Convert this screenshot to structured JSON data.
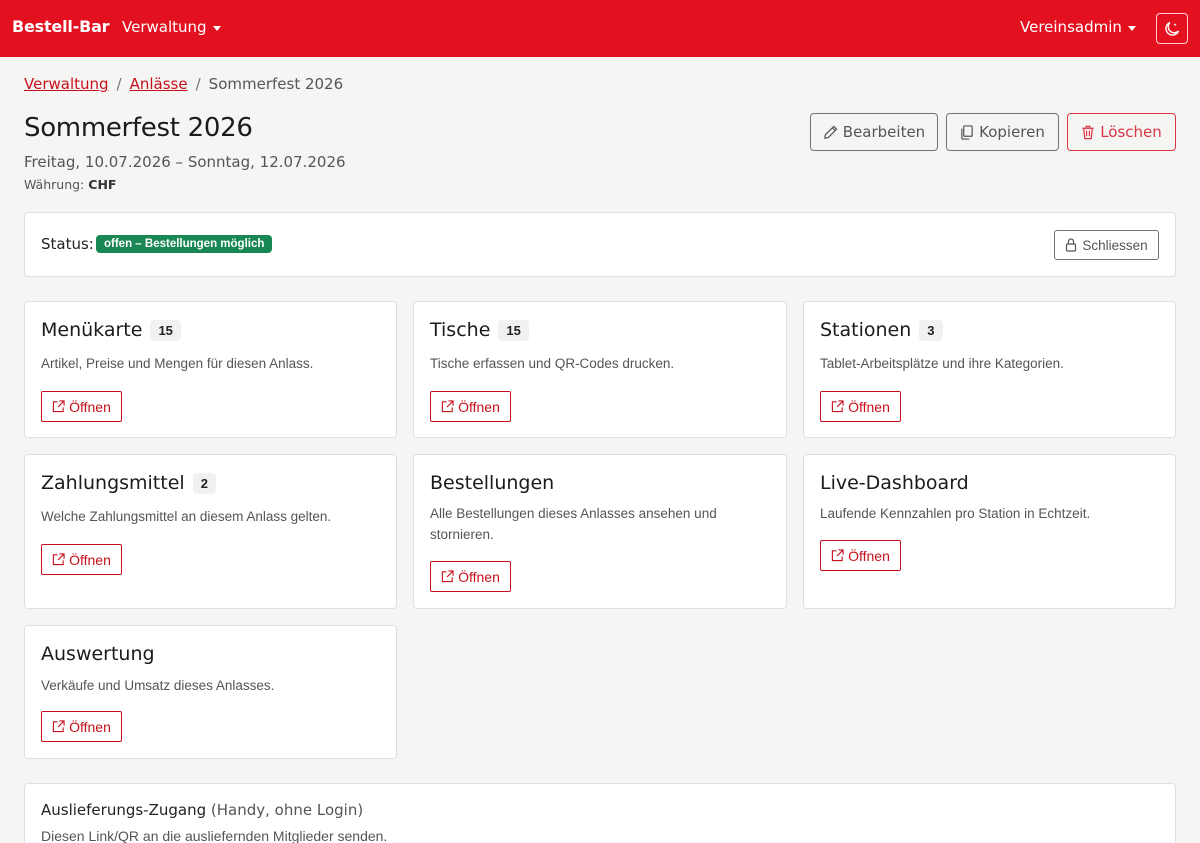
{
  "nav": {
    "brand": "Bestell-Bar",
    "admin_menu": "Verwaltung",
    "user_menu": "Vereinsadmin"
  },
  "breadcrumb": {
    "items": [
      "Verwaltung",
      "Anlässe"
    ],
    "separator": "/",
    "current": "Sommerfest 2026"
  },
  "header": {
    "title": "Sommerfest 2026",
    "dates": "Freitag, 10.07.2026 – Sonntag, 12.07.2026",
    "currency_label": "Währung:",
    "currency_value": "CHF",
    "edit_label": "Bearbeiten",
    "copy_label": "Kopieren",
    "delete_label": "Löschen"
  },
  "status": {
    "label": "Status:",
    "badge": "offen – Bestellungen möglich",
    "close_label": "Schliessen"
  },
  "cards": [
    {
      "title": "Menükarte",
      "count": "15",
      "desc": "Artikel, Preise und Mengen für diesen Anlass.",
      "button": "Öffnen"
    },
    {
      "title": "Tische",
      "count": "15",
      "desc": "Tische erfassen und QR-Codes drucken.",
      "button": "Öffnen"
    },
    {
      "title": "Stationen",
      "count": "3",
      "desc": "Tablet-Arbeitsplätze und ihre Kategorien.",
      "button": "Öffnen"
    },
    {
      "title": "Zahlungsmittel",
      "count": "2",
      "desc": "Welche Zahlungsmittel an diesem Anlass gelten.",
      "button": "Öffnen"
    },
    {
      "title": "Bestellungen",
      "count": "",
      "desc": "Alle Bestellungen dieses Anlasses ansehen und stornieren.",
      "button": "Öffnen"
    },
    {
      "title": "Live-Dashboard",
      "count": "",
      "desc": "Laufende Kennzahlen pro Station in Echtzeit.",
      "button": "Öffnen"
    },
    {
      "title": "Auswertung",
      "count": "",
      "desc": "Verkäufe und Umsatz dieses Anlasses.",
      "button": "Öffnen"
    }
  ],
  "delivery": {
    "title": "Auslieferungs-Zugang",
    "title_note": "(Handy, ohne Login)",
    "desc": "Diesen Link/QR an die ausliefernden Mitglieder senden."
  },
  "colors": {
    "brand_red": "#e31020",
    "link_red": "#c8101c",
    "danger": "#dc3545",
    "success": "#198754"
  },
  "icons": {
    "theme": "moon-icon",
    "edit": "pencil-icon",
    "copy": "copy-icon",
    "delete": "trash-icon",
    "lock": "lock-icon",
    "open": "external-link-icon"
  }
}
